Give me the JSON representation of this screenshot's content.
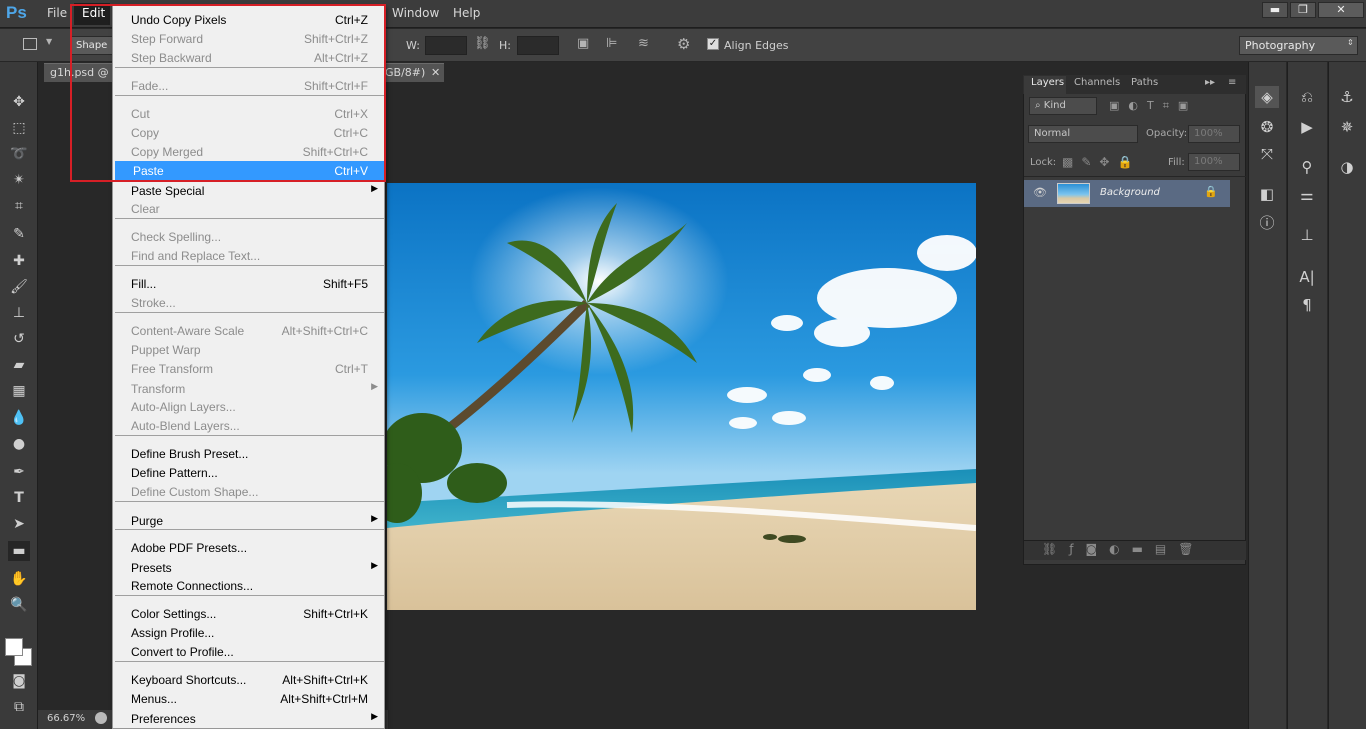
{
  "app": {
    "logo": "Ps"
  },
  "menubar": {
    "file": "File",
    "edit": "Edit",
    "window": "Window",
    "help": "Help"
  },
  "window_controls": {
    "minimize": "▬",
    "restore": "❐",
    "close": "✕"
  },
  "options": {
    "shape_mode": "Shape",
    "w_label": "W:",
    "h_label": "H:",
    "align_edges": "Align Edges",
    "preset": "Photography"
  },
  "document": {
    "tab_title_left": "g1h.psd @",
    "tab_title_right": "GB/8#)",
    "tab_close": "✕",
    "zoom": "66.67%"
  },
  "layers_panel": {
    "tabs": [
      "Layers",
      "Channels",
      "Paths"
    ],
    "kind": "Kind",
    "blend_mode": "Normal",
    "opacity_label": "Opacity:",
    "opacity_value": "100%",
    "lock_label": "Lock:",
    "fill_label": "Fill:",
    "fill_value": "100%",
    "layer_name": "Background"
  },
  "edit_menu": {
    "items": [
      {
        "label": "Undo Copy Pixels",
        "shortcut": "Ctrl+Z",
        "disabled": false
      },
      {
        "label": "Step Forward",
        "shortcut": "Shift+Ctrl+Z",
        "disabled": true
      },
      {
        "label": "Step Backward",
        "shortcut": "Alt+Ctrl+Z",
        "disabled": true
      },
      {
        "label": "Fade...",
        "shortcut": "Shift+Ctrl+F",
        "disabled": true
      },
      {
        "label": "Cut",
        "shortcut": "Ctrl+X",
        "disabled": true
      },
      {
        "label": "Copy",
        "shortcut": "Ctrl+C",
        "disabled": true
      },
      {
        "label": "Copy Merged",
        "shortcut": "Shift+Ctrl+C",
        "disabled": true
      },
      {
        "label": "Paste",
        "shortcut": "Ctrl+V",
        "disabled": false,
        "highlighted": true
      },
      {
        "label": "Paste Special",
        "shortcut": "",
        "disabled": false,
        "submenu": true
      },
      {
        "label": "Clear",
        "shortcut": "",
        "disabled": true
      },
      {
        "label": "Check Spelling...",
        "shortcut": "",
        "disabled": true
      },
      {
        "label": "Find and Replace Text...",
        "shortcut": "",
        "disabled": true
      },
      {
        "label": "Fill...",
        "shortcut": "Shift+F5",
        "disabled": false
      },
      {
        "label": "Stroke...",
        "shortcut": "",
        "disabled": true
      },
      {
        "label": "Content-Aware Scale",
        "shortcut": "Alt+Shift+Ctrl+C",
        "disabled": true
      },
      {
        "label": "Puppet Warp",
        "shortcut": "",
        "disabled": true
      },
      {
        "label": "Free Transform",
        "shortcut": "Ctrl+T",
        "disabled": true
      },
      {
        "label": "Transform",
        "shortcut": "",
        "disabled": true,
        "submenu": true
      },
      {
        "label": "Auto-Align Layers...",
        "shortcut": "",
        "disabled": true
      },
      {
        "label": "Auto-Blend Layers...",
        "shortcut": "",
        "disabled": true
      },
      {
        "label": "Define Brush Preset...",
        "shortcut": "",
        "disabled": false
      },
      {
        "label": "Define Pattern...",
        "shortcut": "",
        "disabled": false
      },
      {
        "label": "Define Custom Shape...",
        "shortcut": "",
        "disabled": true
      },
      {
        "label": "Purge",
        "shortcut": "",
        "disabled": false,
        "submenu": true
      },
      {
        "label": "Adobe PDF Presets...",
        "shortcut": "",
        "disabled": false
      },
      {
        "label": "Presets",
        "shortcut": "",
        "disabled": false,
        "submenu": true
      },
      {
        "label": "Remote Connections...",
        "shortcut": "",
        "disabled": false
      },
      {
        "label": "Color Settings...",
        "shortcut": "Shift+Ctrl+K",
        "disabled": false
      },
      {
        "label": "Assign Profile...",
        "shortcut": "",
        "disabled": false
      },
      {
        "label": "Convert to Profile...",
        "shortcut": "",
        "disabled": false
      },
      {
        "label": "Keyboard Shortcuts...",
        "shortcut": "Alt+Shift+Ctrl+K",
        "disabled": false
      },
      {
        "label": "Menus...",
        "shortcut": "Alt+Shift+Ctrl+M",
        "disabled": false
      },
      {
        "label": "Preferences",
        "shortcut": "",
        "disabled": false,
        "submenu": true
      }
    ]
  },
  "colors": {
    "highlight": "#3399ff",
    "annotation_box": "#d61f26",
    "layer_selected": "#5a6a83",
    "logo": "#4ea6e8"
  }
}
